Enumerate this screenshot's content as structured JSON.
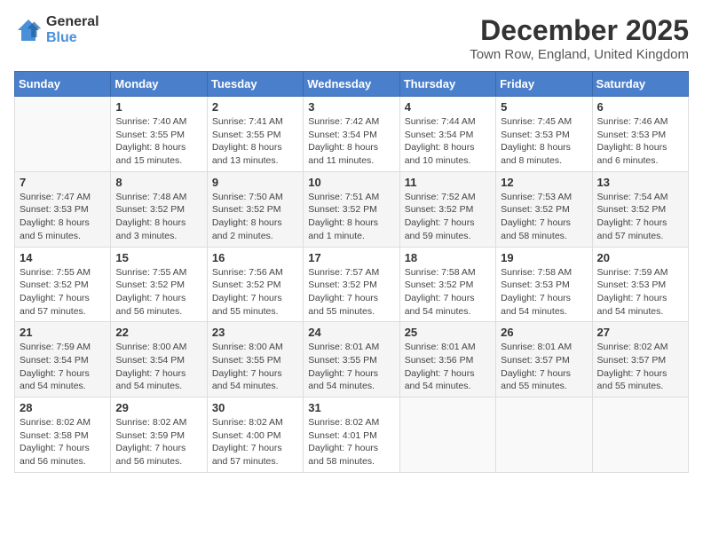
{
  "header": {
    "logo_line1": "General",
    "logo_line2": "Blue",
    "month_title": "December 2025",
    "location": "Town Row, England, United Kingdom"
  },
  "days_of_week": [
    "Sunday",
    "Monday",
    "Tuesday",
    "Wednesday",
    "Thursday",
    "Friday",
    "Saturday"
  ],
  "weeks": [
    [
      {
        "day": "",
        "info": ""
      },
      {
        "day": "1",
        "info": "Sunrise: 7:40 AM\nSunset: 3:55 PM\nDaylight: 8 hours\nand 15 minutes."
      },
      {
        "day": "2",
        "info": "Sunrise: 7:41 AM\nSunset: 3:55 PM\nDaylight: 8 hours\nand 13 minutes."
      },
      {
        "day": "3",
        "info": "Sunrise: 7:42 AM\nSunset: 3:54 PM\nDaylight: 8 hours\nand 11 minutes."
      },
      {
        "day": "4",
        "info": "Sunrise: 7:44 AM\nSunset: 3:54 PM\nDaylight: 8 hours\nand 10 minutes."
      },
      {
        "day": "5",
        "info": "Sunrise: 7:45 AM\nSunset: 3:53 PM\nDaylight: 8 hours\nand 8 minutes."
      },
      {
        "day": "6",
        "info": "Sunrise: 7:46 AM\nSunset: 3:53 PM\nDaylight: 8 hours\nand 6 minutes."
      }
    ],
    [
      {
        "day": "7",
        "info": "Sunrise: 7:47 AM\nSunset: 3:53 PM\nDaylight: 8 hours\nand 5 minutes."
      },
      {
        "day": "8",
        "info": "Sunrise: 7:48 AM\nSunset: 3:52 PM\nDaylight: 8 hours\nand 3 minutes."
      },
      {
        "day": "9",
        "info": "Sunrise: 7:50 AM\nSunset: 3:52 PM\nDaylight: 8 hours\nand 2 minutes."
      },
      {
        "day": "10",
        "info": "Sunrise: 7:51 AM\nSunset: 3:52 PM\nDaylight: 8 hours\nand 1 minute."
      },
      {
        "day": "11",
        "info": "Sunrise: 7:52 AM\nSunset: 3:52 PM\nDaylight: 7 hours\nand 59 minutes."
      },
      {
        "day": "12",
        "info": "Sunrise: 7:53 AM\nSunset: 3:52 PM\nDaylight: 7 hours\nand 58 minutes."
      },
      {
        "day": "13",
        "info": "Sunrise: 7:54 AM\nSunset: 3:52 PM\nDaylight: 7 hours\nand 57 minutes."
      }
    ],
    [
      {
        "day": "14",
        "info": "Sunrise: 7:55 AM\nSunset: 3:52 PM\nDaylight: 7 hours\nand 57 minutes."
      },
      {
        "day": "15",
        "info": "Sunrise: 7:55 AM\nSunset: 3:52 PM\nDaylight: 7 hours\nand 56 minutes."
      },
      {
        "day": "16",
        "info": "Sunrise: 7:56 AM\nSunset: 3:52 PM\nDaylight: 7 hours\nand 55 minutes."
      },
      {
        "day": "17",
        "info": "Sunrise: 7:57 AM\nSunset: 3:52 PM\nDaylight: 7 hours\nand 55 minutes."
      },
      {
        "day": "18",
        "info": "Sunrise: 7:58 AM\nSunset: 3:52 PM\nDaylight: 7 hours\nand 54 minutes."
      },
      {
        "day": "19",
        "info": "Sunrise: 7:58 AM\nSunset: 3:53 PM\nDaylight: 7 hours\nand 54 minutes."
      },
      {
        "day": "20",
        "info": "Sunrise: 7:59 AM\nSunset: 3:53 PM\nDaylight: 7 hours\nand 54 minutes."
      }
    ],
    [
      {
        "day": "21",
        "info": "Sunrise: 7:59 AM\nSunset: 3:54 PM\nDaylight: 7 hours\nand 54 minutes."
      },
      {
        "day": "22",
        "info": "Sunrise: 8:00 AM\nSunset: 3:54 PM\nDaylight: 7 hours\nand 54 minutes."
      },
      {
        "day": "23",
        "info": "Sunrise: 8:00 AM\nSunset: 3:55 PM\nDaylight: 7 hours\nand 54 minutes."
      },
      {
        "day": "24",
        "info": "Sunrise: 8:01 AM\nSunset: 3:55 PM\nDaylight: 7 hours\nand 54 minutes."
      },
      {
        "day": "25",
        "info": "Sunrise: 8:01 AM\nSunset: 3:56 PM\nDaylight: 7 hours\nand 54 minutes."
      },
      {
        "day": "26",
        "info": "Sunrise: 8:01 AM\nSunset: 3:57 PM\nDaylight: 7 hours\nand 55 minutes."
      },
      {
        "day": "27",
        "info": "Sunrise: 8:02 AM\nSunset: 3:57 PM\nDaylight: 7 hours\nand 55 minutes."
      }
    ],
    [
      {
        "day": "28",
        "info": "Sunrise: 8:02 AM\nSunset: 3:58 PM\nDaylight: 7 hours\nand 56 minutes."
      },
      {
        "day": "29",
        "info": "Sunrise: 8:02 AM\nSunset: 3:59 PM\nDaylight: 7 hours\nand 56 minutes."
      },
      {
        "day": "30",
        "info": "Sunrise: 8:02 AM\nSunset: 4:00 PM\nDaylight: 7 hours\nand 57 minutes."
      },
      {
        "day": "31",
        "info": "Sunrise: 8:02 AM\nSunset: 4:01 PM\nDaylight: 7 hours\nand 58 minutes."
      },
      {
        "day": "",
        "info": ""
      },
      {
        "day": "",
        "info": ""
      },
      {
        "day": "",
        "info": ""
      }
    ]
  ]
}
